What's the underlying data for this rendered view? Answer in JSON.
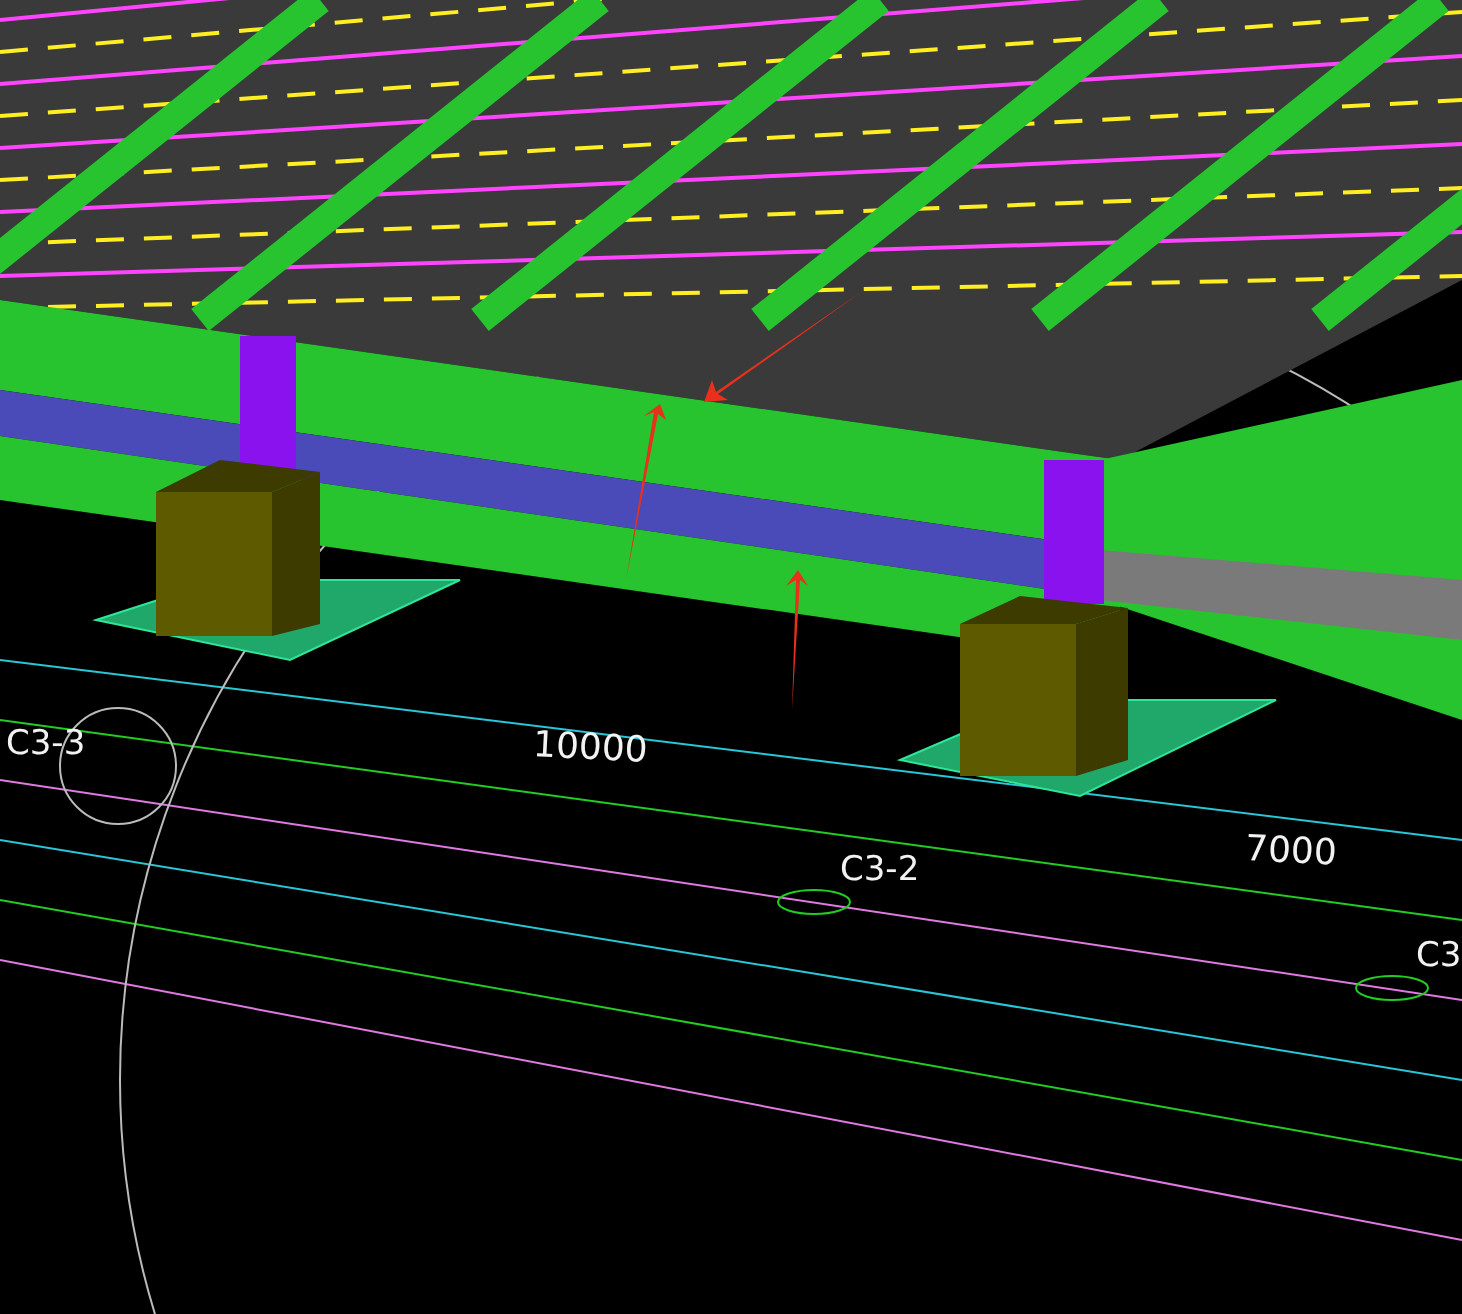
{
  "viewport": {
    "labels": [
      {
        "text": "C3-3",
        "kind": "axis"
      },
      {
        "text": "10000",
        "kind": "dimension"
      },
      {
        "text": "C3-2",
        "kind": "axis"
      },
      {
        "text": "7000",
        "kind": "dimension"
      },
      {
        "text": "C3",
        "kind": "axis"
      }
    ]
  }
}
